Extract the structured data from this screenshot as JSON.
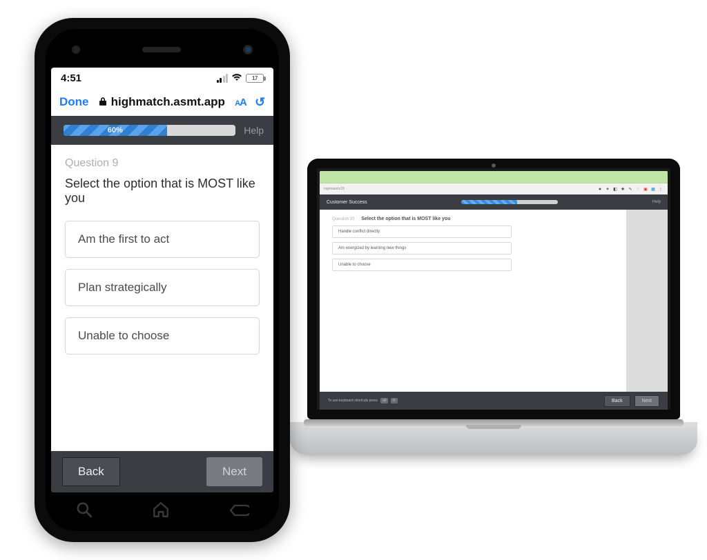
{
  "phone": {
    "status": {
      "time": "4:51",
      "battery_label": "17"
    },
    "safari": {
      "done": "Done",
      "url_host": "highmatch.asmt.app"
    },
    "progress": {
      "percent": 60,
      "label": "60%",
      "help": "Help"
    },
    "question_number": "Question 9",
    "prompt": "Select the option that is MOST like you",
    "options": [
      "Am the first to act",
      "Plan strategically",
      "Unable to choose"
    ],
    "buttons": {
      "back": "Back",
      "next": "Next"
    }
  },
  "laptop": {
    "header_title": "Customer Success",
    "progress": {
      "percent": 58,
      "help": "Help"
    },
    "question_number": "Question 10",
    "prompt": "Select the option that is MOST like you",
    "options": [
      "Handle conflict directly",
      "Am energized by learning new things",
      "Unable to choose"
    ],
    "footer_hint": "To use keyboard shortcuts press",
    "footer_key1": "alt",
    "footer_key2": "K",
    "buttons": {
      "back": "Back",
      "next": "Next"
    }
  }
}
